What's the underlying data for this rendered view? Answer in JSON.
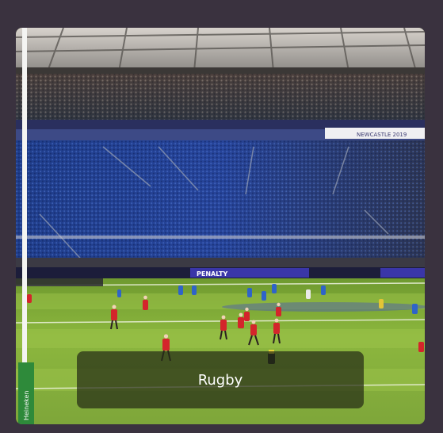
{
  "card": {
    "caption": "Rugby"
  },
  "photo": {
    "banner_text": "PENALTY",
    "stand_text": "NEWCASTLE 2019",
    "post_pad_text": "Heineken"
  },
  "colors": {
    "page_background": "#3a323f",
    "pitch_green": "#8ab43f",
    "team_red": "#d4252b",
    "team_blue": "#2f64c8",
    "crowd_blue": "#22408f"
  }
}
